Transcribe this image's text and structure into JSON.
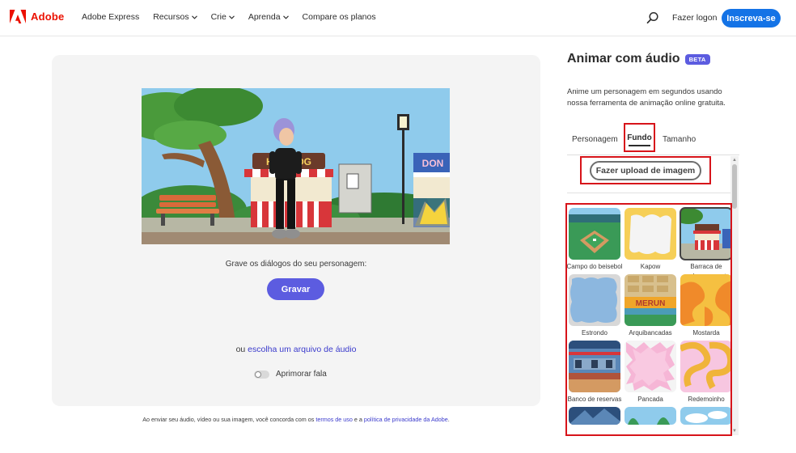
{
  "header": {
    "logo_text": "Adobe",
    "nav": [
      {
        "label": "Adobe Express",
        "has_dropdown": false
      },
      {
        "label": "Recursos",
        "has_dropdown": true
      },
      {
        "label": "Crie",
        "has_dropdown": true
      },
      {
        "label": "Aprenda",
        "has_dropdown": true
      },
      {
        "label": "Compare os planos",
        "has_dropdown": false
      }
    ],
    "login_label": "Fazer logon",
    "signup_label": "Inscreva-se",
    "colors": {
      "brand_red": "#eb1000",
      "signup_blue": "#1473e6"
    }
  },
  "workspace": {
    "record_prompt": "Grave os diálogos do seu personagem:",
    "record_button": "Gravar",
    "audio_prefix": "ou ",
    "audio_link": "escolha um arquivo de áudio",
    "improve_label": "Aprimorar fala",
    "improve_enabled": false,
    "sign_text": "HOT DOG",
    "sign_text_2": "DON",
    "colors": {
      "record_button": "#5c5ce0"
    }
  },
  "terms": {
    "prefix": "Ao enviar seu áudio, vídeo ou sua imagem, você concorda com os ",
    "link1": "termos de uso",
    "middle": " e a ",
    "link2": "política de privacidade da Adobe",
    "suffix": "."
  },
  "panel": {
    "title": "Animar com áudio",
    "badge": "BETA",
    "description": "Anime um personagem em segundos usando nossa ferramenta de animação online gratuita.",
    "tabs": [
      {
        "label": "Personagem",
        "active": false
      },
      {
        "label": "Fundo",
        "active": true
      },
      {
        "label": "Tamanho",
        "active": false
      }
    ],
    "upload_button": "Fazer upload de imagem",
    "backgrounds": [
      {
        "label": "Campo do beisebol",
        "icon": "baseball-field-thumb",
        "selected": false
      },
      {
        "label": "Kapow",
        "icon": "kapow-thumb",
        "selected": false
      },
      {
        "label": "Barraca de cachorro quente",
        "icon": "hotdog-stand-thumb",
        "selected": true
      },
      {
        "label": "Estrondo",
        "icon": "estrondo-thumb",
        "selected": false
      },
      {
        "label": "Arquibancadas",
        "icon": "bleachers-thumb",
        "selected": false
      },
      {
        "label": "Mostarda",
        "icon": "mustard-thumb",
        "selected": false
      },
      {
        "label": "Banco de reservas",
        "icon": "dugout-thumb",
        "selected": false
      },
      {
        "label": "Pancada",
        "icon": "pancada-thumb",
        "selected": false
      },
      {
        "label": "Redemoinho",
        "icon": "swirl-thumb",
        "selected": false
      }
    ],
    "arquibancadas_sign": "MERUN",
    "colors": {
      "highlight": "#d7141a",
      "badge": "#5c5ce0"
    }
  }
}
